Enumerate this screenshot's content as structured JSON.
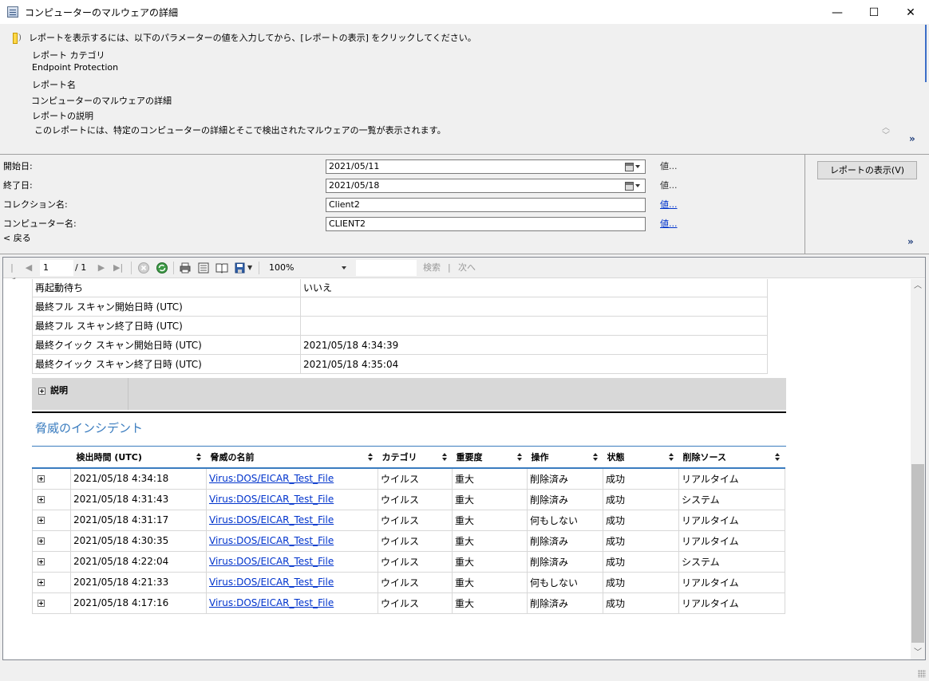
{
  "window": {
    "title": "コンピューターのマルウェアの詳細",
    "minimize": "—",
    "maximize": "☐",
    "close": "✕"
  },
  "info": {
    "instruction": "レポートを表示するには、以下のパラメーターの値を入力してから、[レポートの表示] をクリックしてください。",
    "category_label": "レポート カテゴリ",
    "category_value": "Endpoint Protection",
    "name_label": "レポート名",
    "name_value": "コンピューターのマルウェアの詳細",
    "desc_label": "レポートの説明",
    "desc_value": "このレポートには、特定のコンピューターの詳細とそこで検出されたマルウェアの一覧が表示されます。"
  },
  "params": {
    "start_label": "開始日:",
    "start_value": "2021/05/11",
    "end_label": "終了日:",
    "end_value": "2021/05/18",
    "collection_label": "コレクション名:",
    "collection_value": "Client2",
    "computer_label": "コンピューター名:",
    "computer_value": "CLIENT2",
    "values_text": "値...",
    "view_report": "レポートの表示(V)",
    "back": "< 戻る"
  },
  "toolbar": {
    "page": "1",
    "total": "/ 1",
    "zoom": "100%",
    "search": "検索",
    "divider": "|",
    "next": "次へ"
  },
  "details": [
    {
      "key": "再起動待ち",
      "value": "いいえ"
    },
    {
      "key": "最終フル スキャン開始日時 (UTC)",
      "value": ""
    },
    {
      "key": "最終フル スキャン終了日時 (UTC)",
      "value": ""
    },
    {
      "key": "最終クイック スキャン開始日時 (UTC)",
      "value": "2021/05/18 4:34:39"
    },
    {
      "key": "最終クイック スキャン終了日時 (UTC)",
      "value": "2021/05/18 4:35:04"
    }
  ],
  "description_label": "説明",
  "threats": {
    "title": "脅威のインシデント",
    "headers": [
      "検出時間 (UTC)",
      "脅威の名前",
      "カテゴリ",
      "重要度",
      "操作",
      "状態",
      "削除ソース"
    ],
    "rows": [
      [
        "2021/05/18 4:34:18",
        "Virus:DOS/EICAR_Test_File",
        "ウイルス",
        "重大",
        "削除済み",
        "成功",
        "リアルタイム"
      ],
      [
        "2021/05/18 4:31:43",
        "Virus:DOS/EICAR_Test_File",
        "ウイルス",
        "重大",
        "削除済み",
        "成功",
        "システム"
      ],
      [
        "2021/05/18 4:31:17",
        "Virus:DOS/EICAR_Test_File",
        "ウイルス",
        "重大",
        "何もしない",
        "成功",
        "リアルタイム"
      ],
      [
        "2021/05/18 4:30:35",
        "Virus:DOS/EICAR_Test_File",
        "ウイルス",
        "重大",
        "削除済み",
        "成功",
        "リアルタイム"
      ],
      [
        "2021/05/18 4:22:04",
        "Virus:DOS/EICAR_Test_File",
        "ウイルス",
        "重大",
        "削除済み",
        "成功",
        "システム"
      ],
      [
        "2021/05/18 4:21:33",
        "Virus:DOS/EICAR_Test_File",
        "ウイルス",
        "重大",
        "何もしない",
        "成功",
        "リアルタイム"
      ],
      [
        "2021/05/18 4:17:16",
        "Virus:DOS/EICAR_Test_File",
        "ウイルス",
        "重大",
        "削除済み",
        "成功",
        "リアルタイム"
      ]
    ]
  },
  "colors": {
    "accent": "#3a7cbf",
    "link": "#0033cc"
  }
}
